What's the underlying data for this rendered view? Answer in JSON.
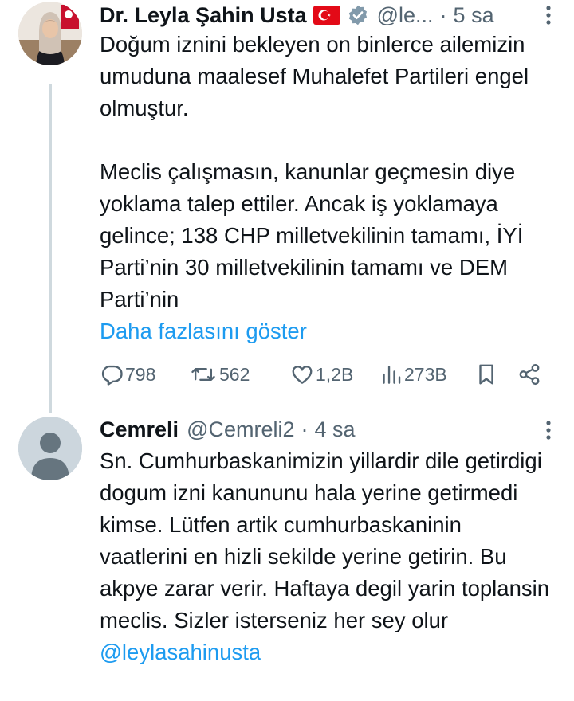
{
  "tweet1": {
    "author_name": "Dr. Leyla Şahin Usta",
    "handle": "@le...",
    "dot": "·",
    "time": "5 sa",
    "paragraph1": "Doğum iznini bekleyen on binlerce ailemizin umuduna maalesef Muhalefet Partileri engel olmuştur.",
    "paragraph2": "Meclis çalışmasın, kanunlar geçmesin diye yoklama talep ettiler. Ancak iş yoklamaya gelince; 138 CHP milletvekilinin tamamı, İYİ Parti’nin 30 milletvekilinin tamamı ve DEM Parti’nin",
    "show_more": "Daha fazlasını göster",
    "actions": {
      "replies": "798",
      "reposts": "562",
      "likes": "1,2B",
      "views": "273B"
    },
    "icons": [
      "turkey-flag-icon",
      "verified-badge-icon",
      "more-icon",
      "reply-icon",
      "repost-icon",
      "like-icon",
      "views-icon",
      "bookmark-icon",
      "share-icon"
    ]
  },
  "tweet2": {
    "author_name": "Cemreli",
    "handle": "@Cemreli2",
    "dot": "·",
    "time": "4 sa",
    "body": "Sn. Cumhurbaskanimizin yillardir dile getirdigi dogum izni kanununu hala yerine getirmedi kimse. Lütfen artik cumhurbaskaninin vaatlerini en hizli sekilde yerine getirin. Bu akpye zarar verir. Haftaya degil yarin toplansin meclis. Sizler isterseniz her sey olur",
    "mention": "@leylasahinusta"
  },
  "colors": {
    "text": "#0f1419",
    "secondary": "#536471",
    "link": "#1d9bf0",
    "thread_line": "#cfd9de",
    "flag_red": "#e30a17",
    "verified_gray": "#829aab"
  }
}
